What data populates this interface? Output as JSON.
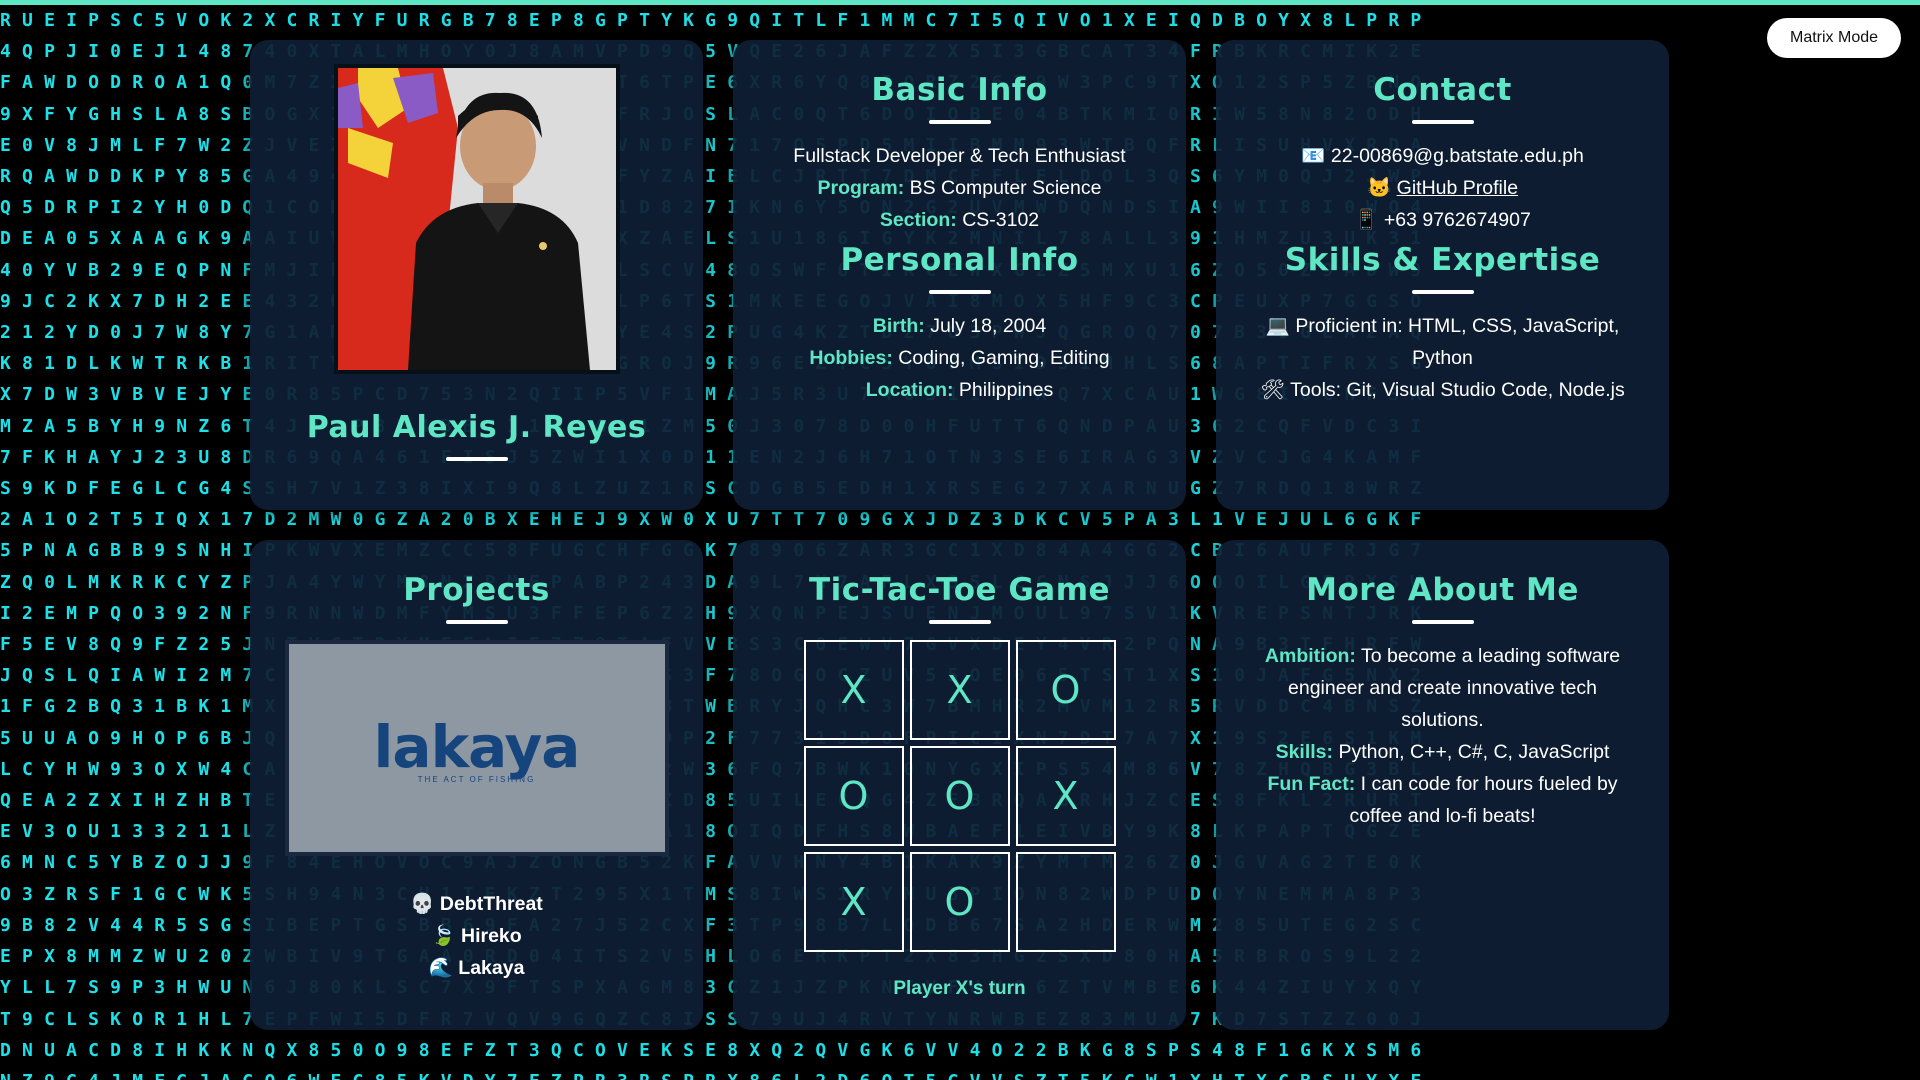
{
  "matrix_button": "Matrix Mode",
  "profile": {
    "name": "Paul Alexis J. Reyes"
  },
  "basic_info": {
    "title": "Basic Info",
    "tagline": "Fullstack Developer & Tech Enthusiast",
    "program_label": "Program:",
    "program": "BS Computer Science",
    "section_label": "Section:",
    "section": "CS-3102"
  },
  "personal_info": {
    "title": "Personal Info",
    "birth_label": "Birth:",
    "birth": "July 18, 2004",
    "hobbies_label": "Hobbies:",
    "hobbies": "Coding, Gaming, Editing",
    "location_label": "Location:",
    "location": "Philippines"
  },
  "contact": {
    "title": "Contact",
    "email_icon": "📧",
    "email": "22-00869@g.batstate.edu.ph",
    "github_icon": "🐱",
    "github": "GitHub Profile",
    "phone_icon": "📱",
    "phone": "+63 9762674907"
  },
  "skills": {
    "title": "Skills & Expertise",
    "proficient_icon": "💻",
    "proficient_1": "Proficient in: HTML, CSS, JavaScript,",
    "proficient_2": "Python",
    "tools_icon": "🛠",
    "tools": "Tools: Git, Visual Studio Code, Node.js"
  },
  "projects": {
    "title": "Projects",
    "image_logo": "lakaya",
    "image_tagline": "THE ACT OF FISHING",
    "items": [
      {
        "icon": "💀",
        "label": "DebtThreat"
      },
      {
        "icon": "🍃",
        "label": "Hireko"
      },
      {
        "icon": "🌊",
        "label": "Lakaya"
      }
    ]
  },
  "game": {
    "title": "Tic-Tac-Toe Game",
    "cells": [
      "X",
      "X",
      "O",
      "O",
      "O",
      "X",
      "X",
      "O",
      ""
    ],
    "status": "Player X's turn"
  },
  "more": {
    "title": "More About Me",
    "ambition_label": "Ambition:",
    "ambition_1": "To become a leading software",
    "ambition_2": "engineer and create innovative tech",
    "ambition_3": "solutions.",
    "skills_label": "Skills:",
    "skills": "Python, C++, C#, C, JavaScript",
    "fun_label": "Fun Fact:",
    "fun_1": "I can code for hours fueled by",
    "fun_2": "coffee and lo-fi beats!"
  },
  "colors": {
    "accent": "#5fe6c4",
    "card": "#0e1e34",
    "rain": "#1ee0e8"
  }
}
